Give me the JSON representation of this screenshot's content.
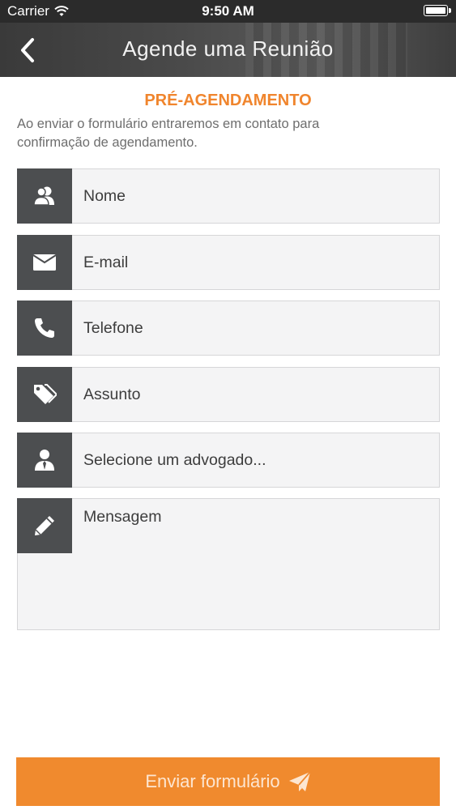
{
  "status_bar": {
    "carrier": "Carrier",
    "time": "9:50 AM"
  },
  "nav": {
    "title": "Agende uma Reunião",
    "back_icon": "chevron-left-icon"
  },
  "form": {
    "heading": "PRÉ-AGENDAMENTO",
    "description": "Ao enviar o formulário entraremos em contato para confirmação de agendamento.",
    "fields": [
      {
        "placeholder": "Nome",
        "icon": "users-icon"
      },
      {
        "placeholder": "E-mail",
        "icon": "envelope-icon"
      },
      {
        "placeholder": "Telefone",
        "icon": "phone-icon"
      },
      {
        "placeholder": "Assunto",
        "icon": "tags-icon"
      },
      {
        "placeholder": "Selecione um advogado...",
        "icon": "user-tie-icon"
      },
      {
        "placeholder": "Mensagem",
        "icon": "pencil-icon"
      }
    ],
    "submit_label": "Enviar formulário",
    "submit_icon": "paper-plane-icon"
  },
  "colors": {
    "accent": "#f08a2e",
    "icon_bg": "#4c4e50",
    "field_bg": "#f4f4f5",
    "heading": "#f0852d"
  }
}
